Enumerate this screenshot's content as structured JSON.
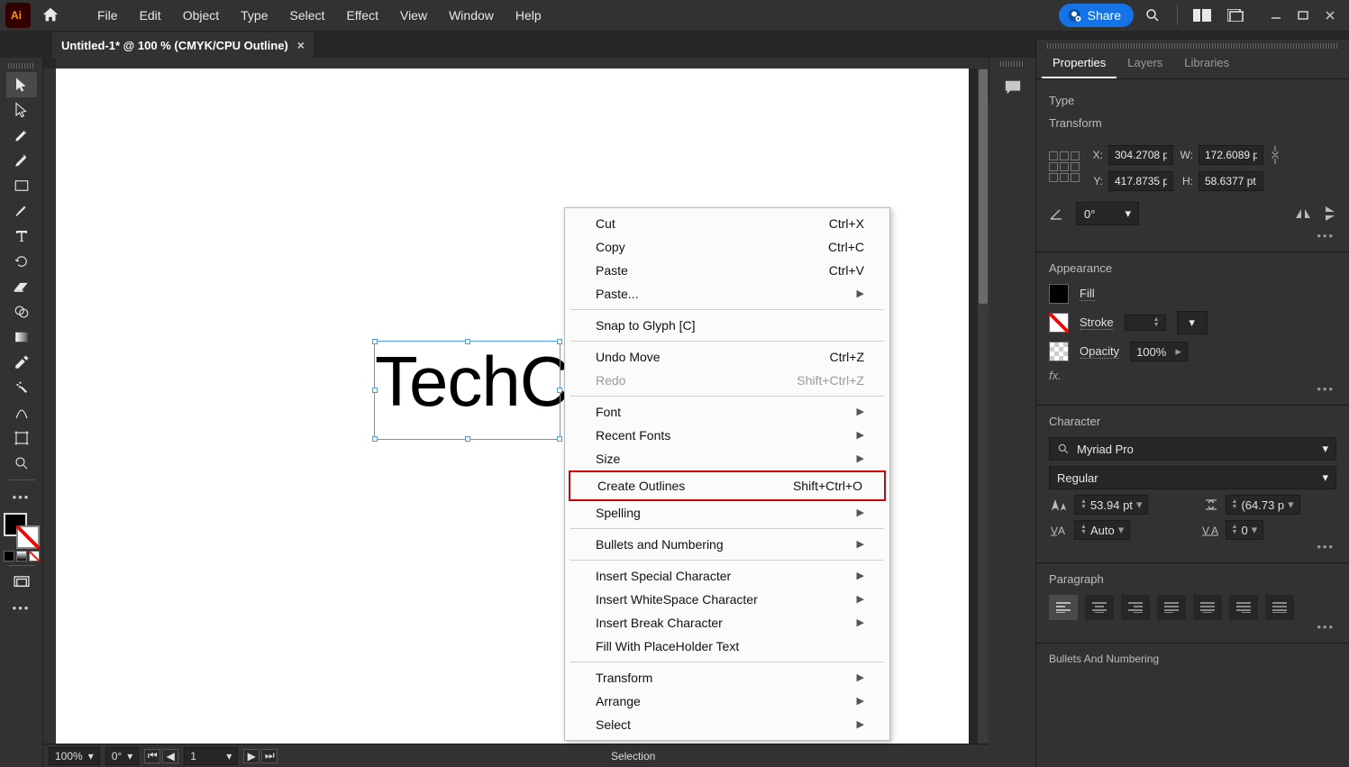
{
  "menubar": {
    "items": [
      "File",
      "Edit",
      "Object",
      "Type",
      "Select",
      "Effect",
      "View",
      "Window",
      "Help"
    ],
    "share_label": "Share"
  },
  "document_tab": {
    "title": "Untitled-1* @ 100 % (CMYK/CPU Outline)"
  },
  "canvas": {
    "text": "TechC"
  },
  "context_menu": {
    "cut": "Cut",
    "cut_sc": "Ctrl+X",
    "copy": "Copy",
    "copy_sc": "Ctrl+C",
    "paste": "Paste",
    "paste_sc": "Ctrl+V",
    "paste_more": "Paste...",
    "snap": "Snap to Glyph [C]",
    "undo": "Undo Move",
    "undo_sc": "Ctrl+Z",
    "redo": "Redo",
    "redo_sc": "Shift+Ctrl+Z",
    "font": "Font",
    "recent": "Recent Fonts",
    "size": "Size",
    "create_outlines": "Create Outlines",
    "create_outlines_sc": "Shift+Ctrl+O",
    "spelling": "Spelling",
    "bullets": "Bullets and Numbering",
    "ispecial": "Insert Special Character",
    "iwhite": "Insert WhiteSpace Character",
    "ibreak": "Insert Break Character",
    "placeholder": "Fill With PlaceHolder Text",
    "transform": "Transform",
    "arrange": "Arrange",
    "select": "Select"
  },
  "panel": {
    "tabs": [
      "Properties",
      "Layers",
      "Libraries"
    ],
    "active_tab": "Properties",
    "object_type": "Type",
    "transform": {
      "title": "Transform",
      "x": "304.2708 p",
      "y": "417.8735 p",
      "w": "172.6089 p",
      "h": "58.6377 pt",
      "angle": "0°"
    },
    "appearance": {
      "title": "Appearance",
      "fill_label": "Fill",
      "stroke_label": "Stroke",
      "opacity_label": "Opacity",
      "opacity_value": "100%"
    },
    "character": {
      "title": "Character",
      "font": "Myriad Pro",
      "style": "Regular",
      "size": "53.94 pt",
      "leading": "(64.73 p",
      "kerning": "Auto",
      "tracking": "0"
    },
    "paragraph": {
      "title": "Paragraph"
    },
    "bullets": {
      "title": "Bullets And Numbering"
    }
  },
  "status": {
    "zoom": "100%",
    "angle": "0°",
    "artboard": "1",
    "mode": "Selection"
  },
  "colors": {
    "accent": "#1473e6",
    "selection": "#4f9eea",
    "highlight": "#d30000"
  }
}
